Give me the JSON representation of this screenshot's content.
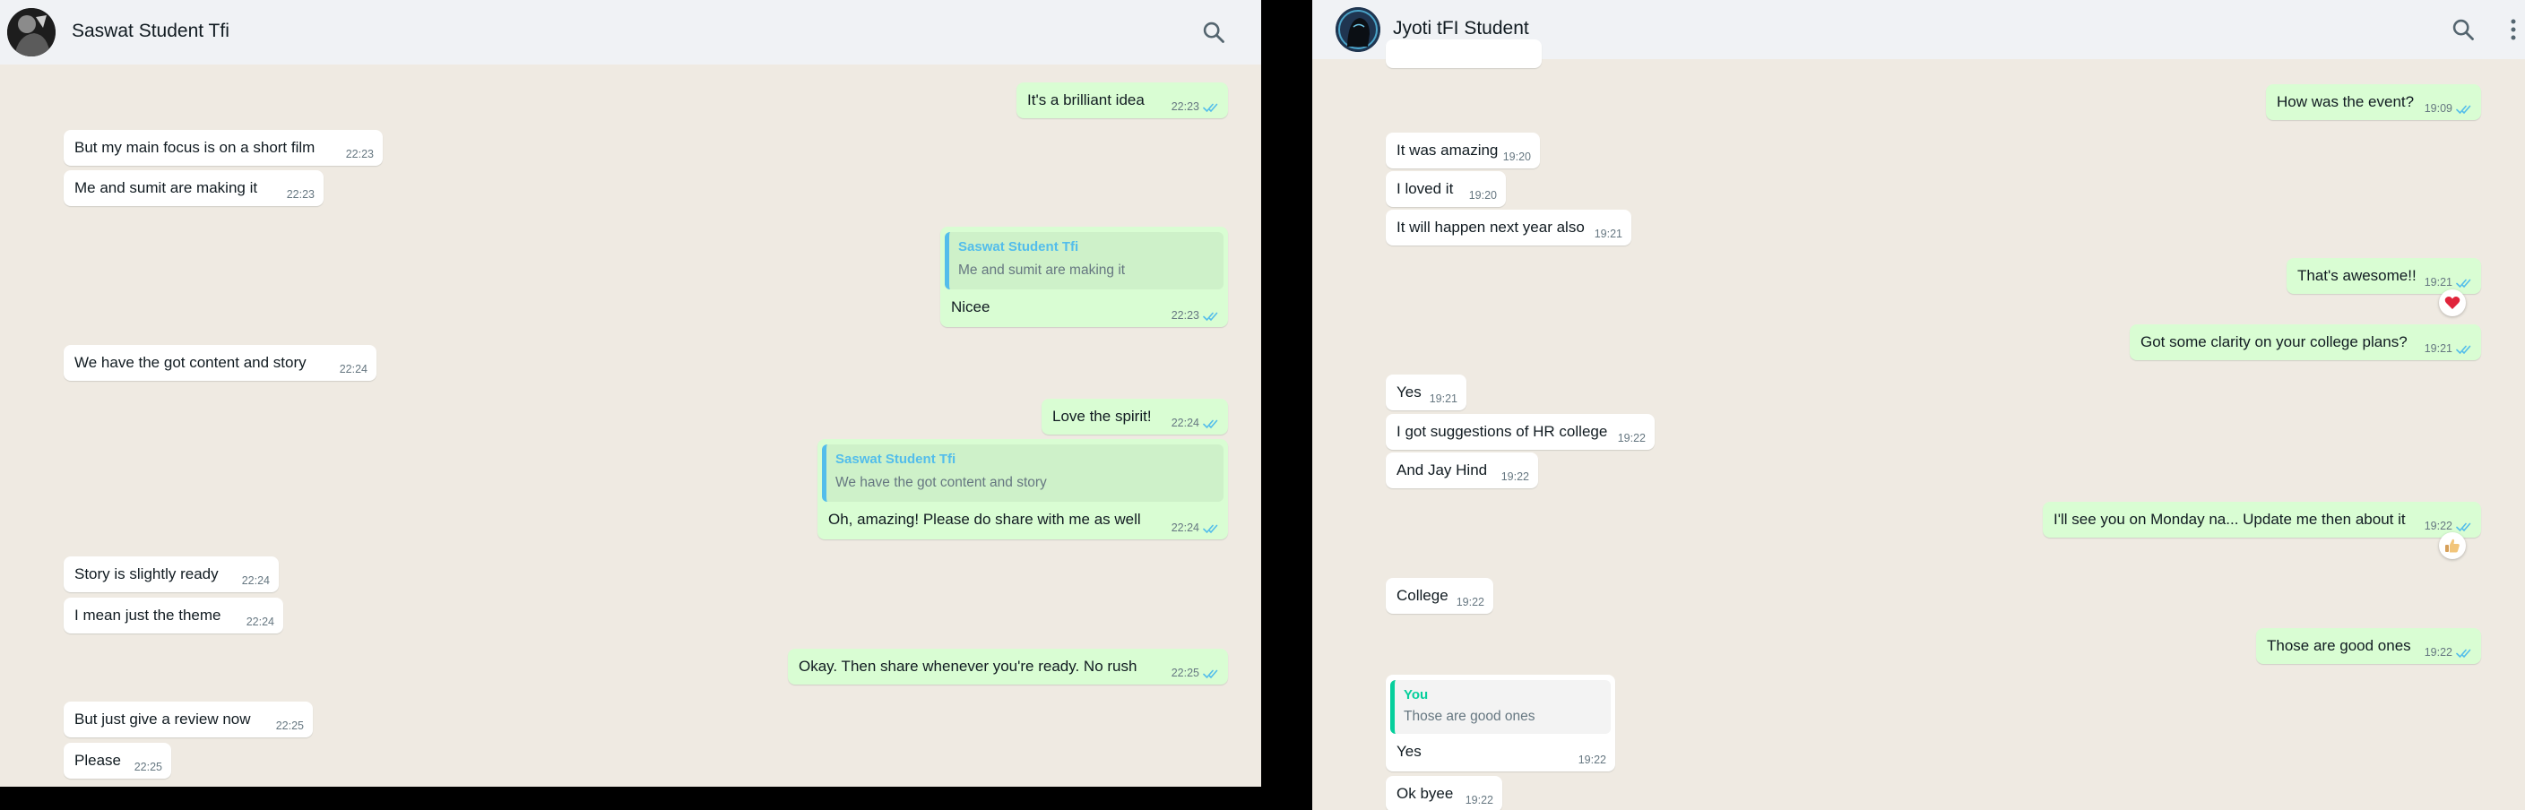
{
  "colors": {
    "chat_background": "#efeae2",
    "header_background": "#f0f2f5",
    "incoming_bubble": "#ffffff",
    "outgoing_bubble": "#d9fdd3",
    "read_ticks": "#53bdeb",
    "quote_author": "#53bdeb",
    "quote_self": "#06cf9c"
  },
  "icons": {
    "search": "search-icon",
    "menu": "more-vertical-icon",
    "read_receipt": "double-check-icon",
    "heart": "heart-reaction-icon",
    "thumbs_up": "thumbs-up-reaction-icon"
  },
  "left": {
    "contact_name": "Saswat Student Tfi",
    "messages": [
      {
        "text": "It's a brilliant idea",
        "time": "22:23"
      },
      {
        "text": "But my main focus is on a short film",
        "time": "22:23"
      },
      {
        "text": "Me and sumit are making it",
        "time": "22:23"
      },
      {
        "quote_name": "Saswat Student Tfi",
        "quote_text": "Me and sumit are making it",
        "text": "Nicee",
        "time": "22:23"
      },
      {
        "text": "We have the got content and story",
        "time": "22:24"
      },
      {
        "text": "Love the spirit!",
        "time": "22:24"
      },
      {
        "quote_name": "Saswat Student Tfi",
        "quote_text": "We have the got content and story",
        "text": "Oh, amazing! Please do share with me as well",
        "time": "22:24"
      },
      {
        "text": "Story is slightly ready",
        "time": "22:24"
      },
      {
        "text": "I mean just the theme",
        "time": "22:24"
      },
      {
        "text": "Okay. Then share whenever you're ready. No rush",
        "time": "22:25"
      },
      {
        "text": "But just give a review now",
        "time": "22:25"
      },
      {
        "text": "Please",
        "time": "22:25"
      }
    ]
  },
  "right": {
    "contact_name": "Jyoti tFI Student",
    "messages": [
      {
        "text": "How was the event?",
        "time": "19:09"
      },
      {
        "text": "It was amazing",
        "time": "19:20"
      },
      {
        "text": "I loved it",
        "time": "19:20"
      },
      {
        "text": "It will happen next year also",
        "time": "19:21"
      },
      {
        "text": "That's awesome!!",
        "time": "19:21"
      },
      {
        "text": "Got some clarity on your college plans?",
        "time": "19:21"
      },
      {
        "text": "Yes",
        "time": "19:21"
      },
      {
        "text": "I got suggestions of HR college",
        "time": "19:22"
      },
      {
        "text": "And Jay Hind",
        "time": "19:22"
      },
      {
        "text": "I'll see you on Monday na... Update me then about it",
        "time": "19:22"
      },
      {
        "text": "College",
        "time": "19:22"
      },
      {
        "text": "Those are good ones",
        "time": "19:22"
      },
      {
        "quote_name": "You",
        "quote_text": "Those are good ones",
        "text": "Yes",
        "time": "19:22"
      },
      {
        "text": "Ok byee",
        "time": "19:22"
      }
    ]
  }
}
